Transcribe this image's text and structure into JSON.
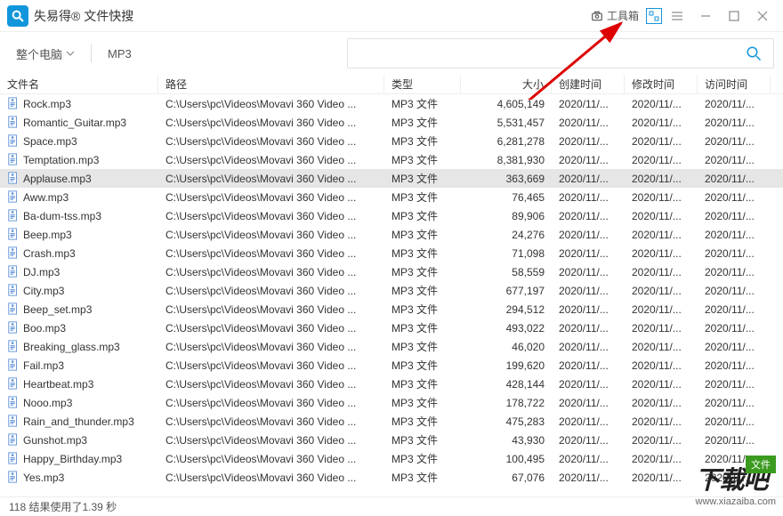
{
  "app": {
    "title": "失易得® 文件快搜",
    "toolbox": "工具箱"
  },
  "search": {
    "scope": "整个电脑",
    "filter": "MP3",
    "placeholder": ""
  },
  "columns": {
    "name": "文件名",
    "path": "路径",
    "type": "类型",
    "size": "大小",
    "ctime": "创建时间",
    "mtime": "修改时间",
    "atime": "访问时间"
  },
  "path_text": "C:\\Users\\pc\\Videos\\Movavi 360 Video ...",
  "type_text": "MP3 文件",
  "date_text": "2020/11/...",
  "selected_index": 4,
  "rows": [
    {
      "name": "Rock.mp3",
      "size": "4,605,149"
    },
    {
      "name": "Romantic_Guitar.mp3",
      "size": "5,531,457"
    },
    {
      "name": "Space.mp3",
      "size": "6,281,278"
    },
    {
      "name": "Temptation.mp3",
      "size": "8,381,930"
    },
    {
      "name": "Applause.mp3",
      "size": "363,669"
    },
    {
      "name": "Aww.mp3",
      "size": "76,465"
    },
    {
      "name": "Ba-dum-tss.mp3",
      "size": "89,906"
    },
    {
      "name": "Beep.mp3",
      "size": "24,276"
    },
    {
      "name": "Crash.mp3",
      "size": "71,098"
    },
    {
      "name": "DJ.mp3",
      "size": "58,559"
    },
    {
      "name": "City.mp3",
      "size": "677,197"
    },
    {
      "name": "Beep_set.mp3",
      "size": "294,512"
    },
    {
      "name": "Boo.mp3",
      "size": "493,022"
    },
    {
      "name": "Breaking_glass.mp3",
      "size": "46,020"
    },
    {
      "name": "Fail.mp3",
      "size": "199,620"
    },
    {
      "name": "Heartbeat.mp3",
      "size": "428,144"
    },
    {
      "name": "Nooo.mp3",
      "size": "178,722"
    },
    {
      "name": "Rain_and_thunder.mp3",
      "size": "475,283"
    },
    {
      "name": "Gunshot.mp3",
      "size": "43,930"
    },
    {
      "name": "Happy_Birthday.mp3",
      "size": "100,495"
    },
    {
      "name": "Yes.mp3",
      "size": "67,076"
    }
  ],
  "status": "118 结果使用了1.39 秒",
  "watermark": {
    "badge": "文件",
    "big": "下载吧",
    "url": "www.xiazaiba.com"
  }
}
